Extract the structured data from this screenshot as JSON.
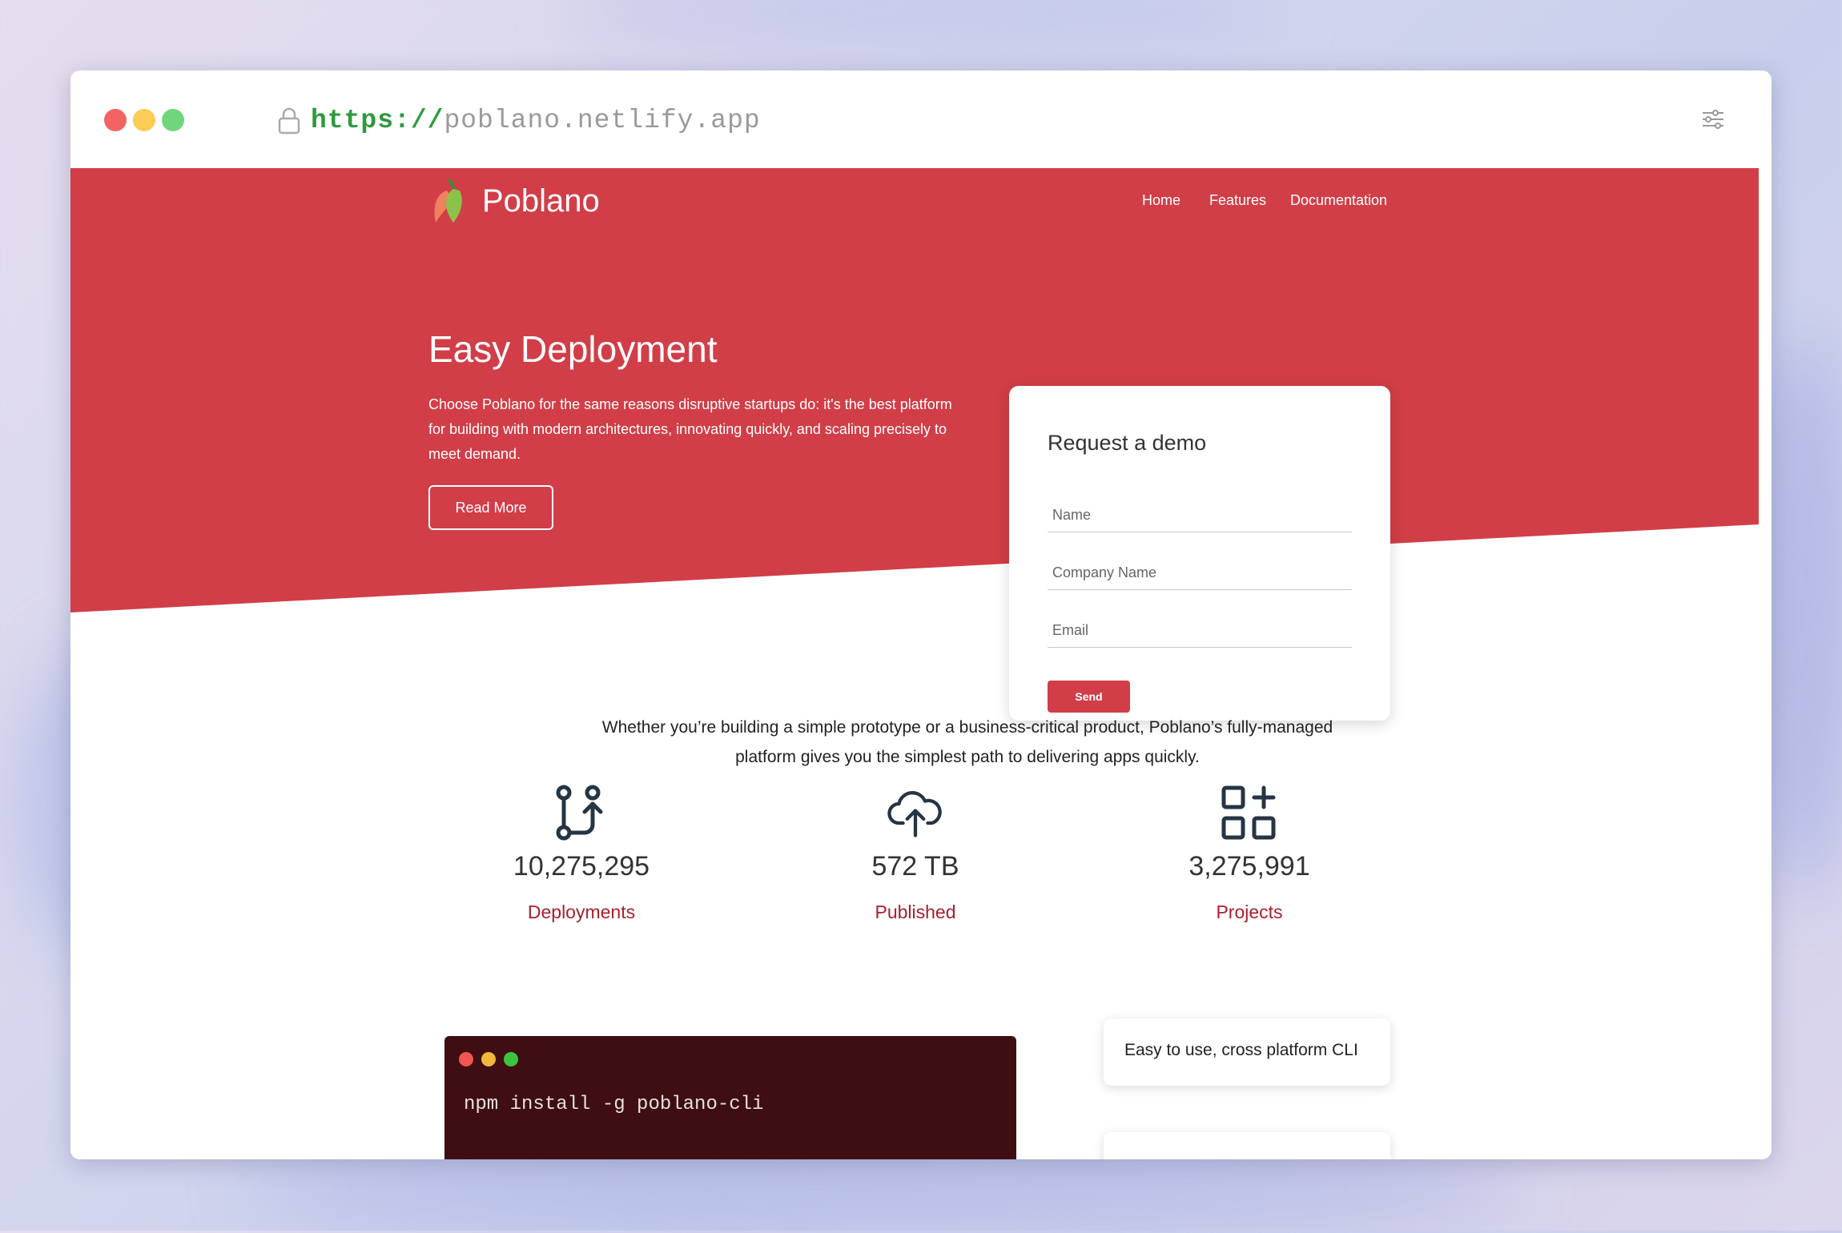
{
  "browser": {
    "url_protocol": "https://",
    "url_host": "poblano.netlify.app",
    "traffic_lights": [
      "#f26363",
      "#fbcb55",
      "#6fd67c"
    ],
    "lock_icon": "lock-icon",
    "settings_icon": "sliders-icon"
  },
  "colors": {
    "brand_red": "#d13e48",
    "accent_label": "#a91f2c",
    "terminal_bg": "#3e0e13"
  },
  "site": {
    "logo_text": "Poblano",
    "nav": [
      "Home",
      "Features",
      "Documentation"
    ]
  },
  "hero": {
    "title": "Easy Deployment",
    "description": "Choose Poblano for the same reasons disruptive startups do: it's the best platform for building with modern architectures, innovating quickly, and scaling precisely to meet demand.",
    "button": "Read More"
  },
  "demo_form": {
    "title": "Request a demo",
    "fields": [
      {
        "placeholder": "Name",
        "value": ""
      },
      {
        "placeholder": "Company Name",
        "value": ""
      },
      {
        "placeholder": "Email",
        "value": ""
      }
    ],
    "submit": "Send"
  },
  "intro": "Whether you’re building a simple prototype or a business-critical product, Poblano’s fully-managed platform gives you the simplest path to delivering apps quickly.",
  "stats": [
    {
      "icon": "git-merge-icon",
      "value": "10,275,295",
      "label": "Deployments"
    },
    {
      "icon": "cloud-upload-icon",
      "value": "572 TB",
      "label": "Published"
    },
    {
      "icon": "add-grid-icon",
      "value": "3,275,991",
      "label": "Projects"
    }
  ],
  "terminal": {
    "command": "npm install -g poblano-cli"
  },
  "features": [
    "Easy to use, cross platform CLI"
  ]
}
